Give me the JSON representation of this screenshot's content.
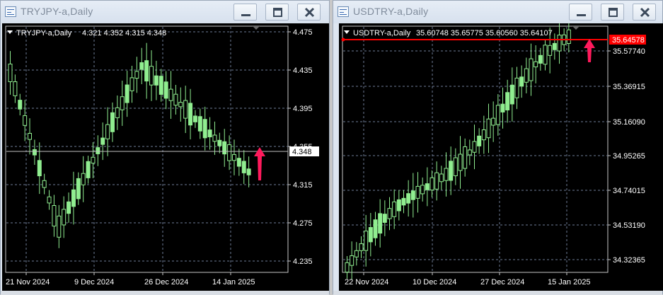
{
  "windows": [
    {
      "title": "TRYJPY-a,Daily",
      "info": {
        "symbol": "TRYJPY-a,Daily",
        "ohlc": "4.321 4.352 4.315 4.348"
      },
      "price_labels": [
        "4.475",
        "4.435",
        "4.395",
        "4.355",
        "4.315",
        "4.275",
        "4.235"
      ],
      "current_price": "4.348",
      "date_labels": [
        "21 Nov 2024",
        "9 Dec 2024",
        "26 Dec 2024",
        "14 Jan 2025"
      ],
      "colors": {
        "candle": "#90ee90",
        "grid": "#6e7b96",
        "price_line": "#c0c0c0",
        "arrow": "#ff1a5c"
      }
    },
    {
      "title": "USDTRY-a,Daily",
      "info": {
        "symbol": "USDTRY-a,Daily",
        "ohlc": "35.60748 35.65775 35.60560 35.64107"
      },
      "price_labels": [
        "35.57740",
        "35.36915",
        "35.16090",
        "34.95265",
        "34.74015",
        "34.53190",
        "34.32365"
      ],
      "current_price": "35.64578",
      "date_labels": [
        "22 Nov 2024",
        "10 Dec 2024",
        "27 Dec 2024",
        "15 Jan 2025"
      ],
      "colors": {
        "candle": "#90ee90",
        "grid": "#6e7b96",
        "price_line": "#ff0000",
        "arrow": "#ff1a5c"
      }
    }
  ],
  "icons": [
    "chart-window-icon",
    "minimize-icon",
    "restore-icon",
    "close-icon",
    "dropdown-triangle-icon",
    "up-arrow-icon"
  ]
}
